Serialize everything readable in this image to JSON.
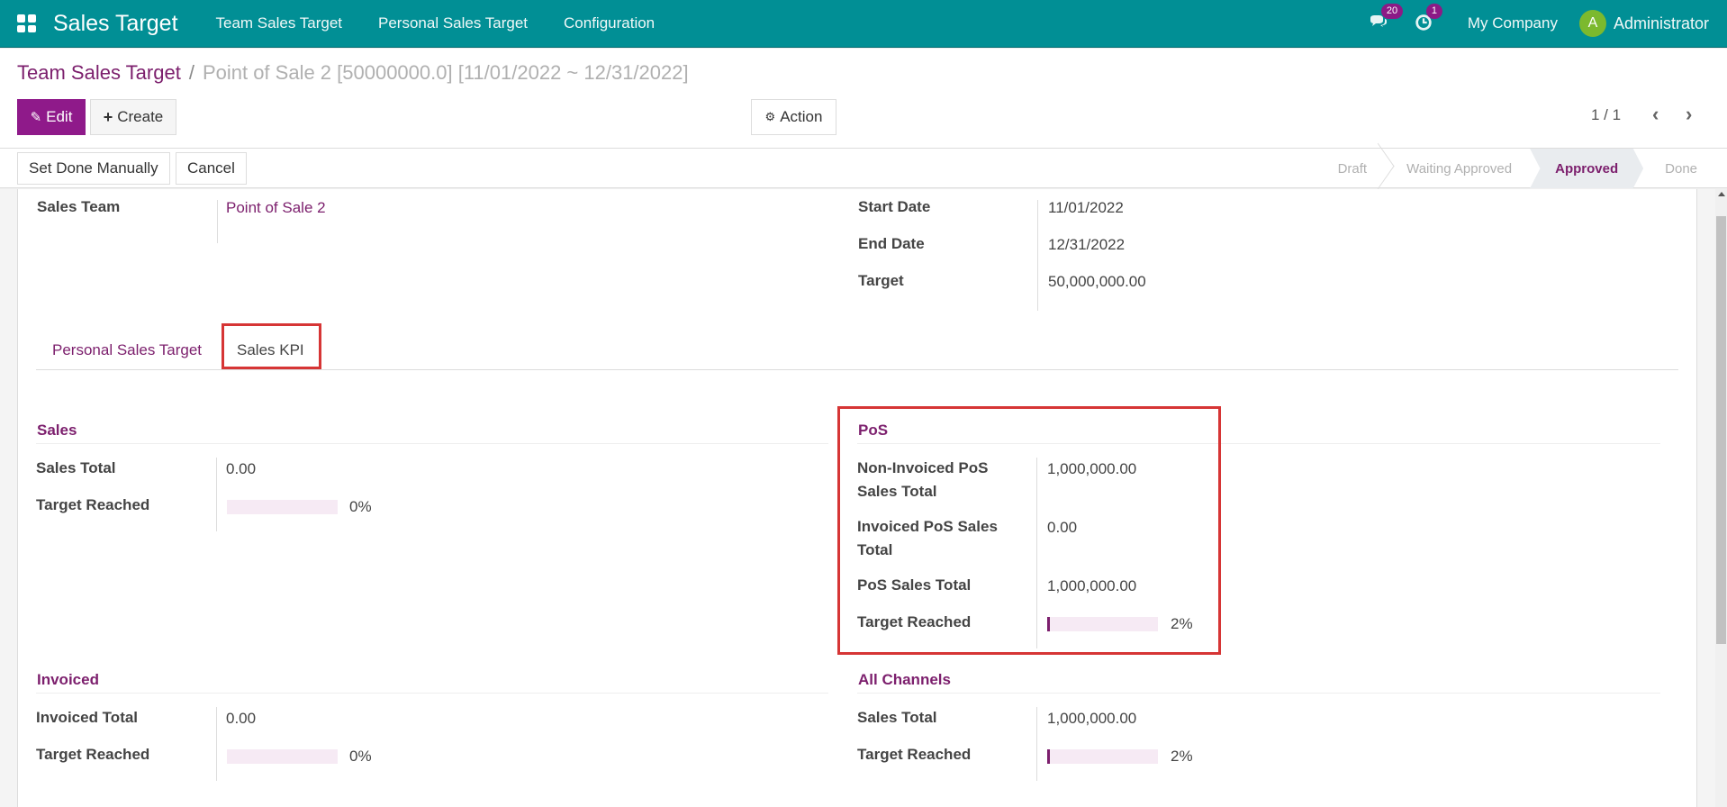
{
  "navbar": {
    "app_title": "Sales Target",
    "menu": [
      "Team Sales Target",
      "Personal Sales Target",
      "Configuration"
    ],
    "messages_count": "20",
    "activities_count": "1",
    "company": "My Company",
    "user_initial": "A",
    "user_name": "Administrator"
  },
  "breadcrumb": {
    "parent": "Team Sales Target",
    "separator": "/",
    "current": "Point of Sale 2 [50000000.0] [11/01/2022 ~ 12/31/2022]"
  },
  "toolbar": {
    "edit_label": "Edit",
    "create_label": "Create",
    "action_label": "Action",
    "pager": "1 / 1"
  },
  "statusbar": {
    "buttons": [
      "Set Done Manually",
      "Cancel"
    ],
    "stages": [
      "Draft",
      "Waiting Approved",
      "Approved",
      "Done"
    ],
    "active_stage": "Approved"
  },
  "form": {
    "sales_team_label": "Sales Team",
    "sales_team_value": "Point of Sale 2",
    "start_date_label": "Start Date",
    "start_date_value": "11/01/2022",
    "end_date_label": "End Date",
    "end_date_value": "12/31/2022",
    "target_label": "Target",
    "target_value": "50,000,000.00"
  },
  "tabs": [
    "Personal Sales Target",
    "Sales KPI"
  ],
  "active_tab": "Sales KPI",
  "kpi": {
    "sales": {
      "title": "Sales",
      "total_label": "Sales Total",
      "total_value": "0.00",
      "reached_label": "Target Reached",
      "reached_pct": 0,
      "reached_text": "0%"
    },
    "pos": {
      "title": "PoS",
      "non_invoiced_label": "Non-Invoiced PoS Sales Total",
      "non_invoiced_value": "1,000,000.00",
      "invoiced_label": "Invoiced PoS Sales Total",
      "invoiced_value": "0.00",
      "total_label": "PoS Sales Total",
      "total_value": "1,000,000.00",
      "reached_label": "Target Reached",
      "reached_pct": 2,
      "reached_text": "2%"
    },
    "invoiced": {
      "title": "Invoiced",
      "total_label": "Invoiced Total",
      "total_value": "0.00",
      "reached_label": "Target Reached",
      "reached_pct": 0,
      "reached_text": "0%"
    },
    "all_channels": {
      "title": "All Channels",
      "total_label": "Sales Total",
      "total_value": "1,000,000.00",
      "reached_label": "Target Reached",
      "reached_pct": 2,
      "reached_text": "2%"
    }
  },
  "colors": {
    "navbar": "#018f95",
    "brand_primary": "#8f1a8a",
    "link": "#7c1f6d",
    "highlight": "#d63535"
  }
}
